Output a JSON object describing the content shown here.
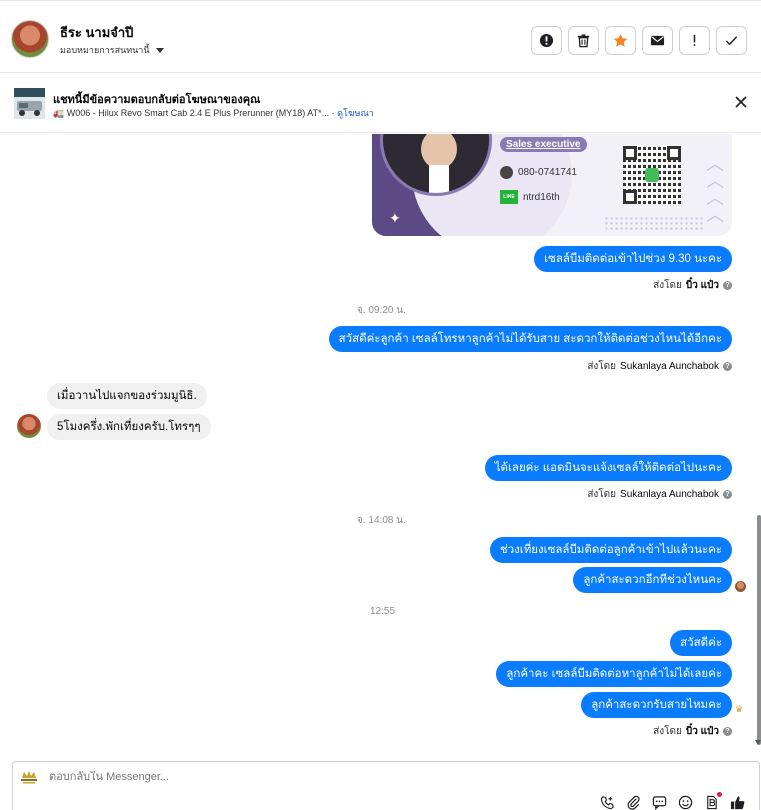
{
  "header": {
    "contact_name": "ธีระ นามจำปี",
    "assign_label": "มอบหมายการสนทนานี้",
    "actions": [
      "mark-spam",
      "delete",
      "star",
      "mark-unread",
      "flag",
      "done"
    ]
  },
  "banner": {
    "title": "แชทนี้มีข้อความตอบกลับต่อโฆษณาของคุณ",
    "subtitle": "🚛 W006 - Hilux Revo Smart Cab 2.4 E Plus Prerunner (MY18) AT*...",
    "link": "ดูโฆษณา"
  },
  "card": {
    "tag": "Sales executive",
    "phone": "080-0741741",
    "line_badge": "LINE",
    "line_id": "ntrd16th"
  },
  "messages": {
    "m1": "เซลล์บีมติดต่อเข้าไปช่วง 9.30  นะคะ",
    "m1_sent_prefix": "ส่งโดย",
    "m1_sender": "บิ๋ว แป๋ว",
    "ts1": "จ. 09:20 น.",
    "m2": "สวัสดีค่ะลูกค้า เซลล์โทรหาลูกค้าไม่ได้รับสาย สะดวกให้ติดต่อช่วงไหนได้อีกคะ",
    "m2_sent_prefix": "ส่งโดย",
    "m2_sender": "Sukanlaya Aunchabok",
    "in1": "เมื่อวานไปแจกของร่วมมูนิธิ.",
    "in2": "5โมงครึ่ง.พักเที่ยงครับ.โทรๆๆ",
    "m3": "ได้เลยค่ะ แอดมินจะแจ้งเซลล์ให้ติดต่อไปนะคะ",
    "m3_sent_prefix": "ส่งโดย",
    "m3_sender": "Sukanlaya Aunchabok",
    "ts2": "จ. 14:08 น.",
    "m4": "ช่วงเที่ยงเซลล์บีมติดต่อลูกค้าเข้าไปแล้วนะคะ",
    "m5": "ลูกค้าสะดวกอีกทีช่วงไหนคะ",
    "ts3": "12:55",
    "m6": "สวัสดีค่ะ",
    "m7": "ลูกค้าคะ เซลล์บีมติดต่อหาลูกค้าไม่ได้เลยค่ะ",
    "m8": "ลูกค้าสะดวกรับสายไหมคะ",
    "m8_sent_prefix": "ส่งโดย",
    "m8_sender": "บิ๋ว แป๋ว"
  },
  "composer": {
    "placeholder": "ตอบกลับใน Messenger..."
  },
  "colors": {
    "bubble_blue": "#0a7cff",
    "bubble_gray": "#f0f0f0",
    "star_orange": "#f5821f",
    "link_blue": "#1d4ed8"
  }
}
